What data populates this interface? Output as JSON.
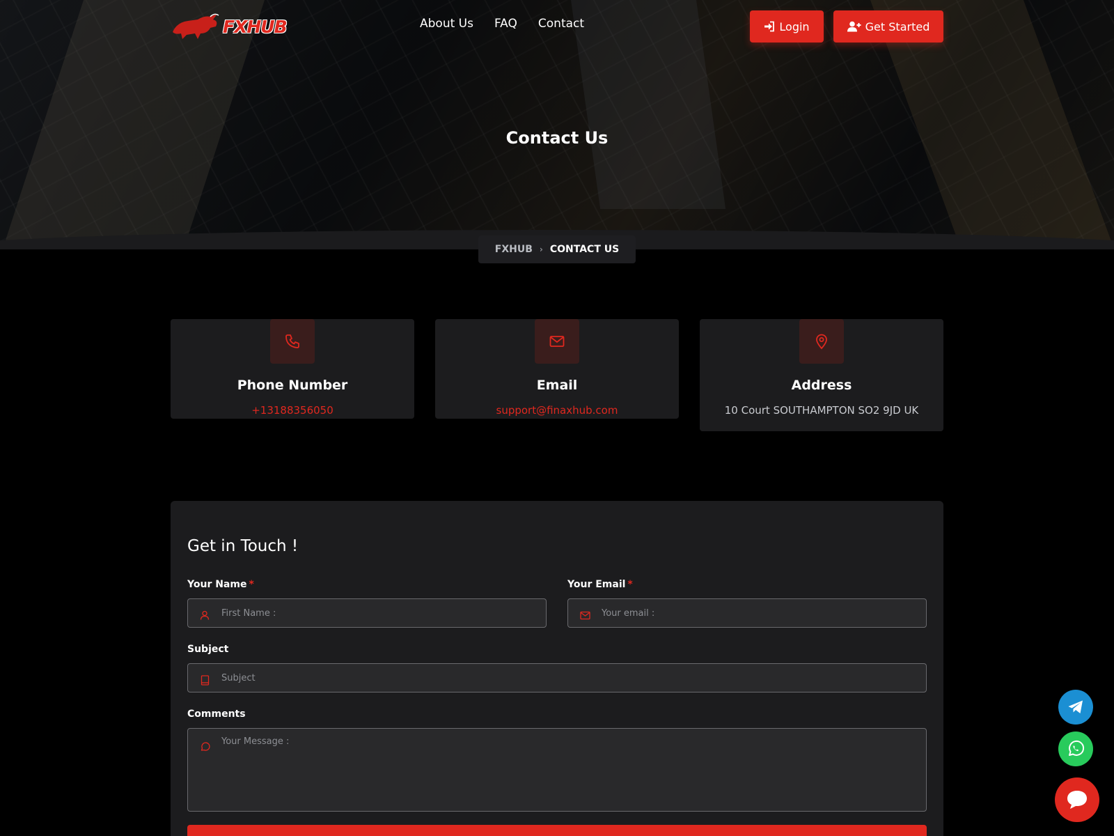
{
  "header": {
    "logo_text": "FXHUB",
    "nav": [
      {
        "label": "About Us"
      },
      {
        "label": "FAQ"
      },
      {
        "label": "Contact"
      }
    ],
    "login_label": "Login",
    "get_started_label": "Get Started"
  },
  "hero": {
    "title": "Contact Us"
  },
  "breadcrumb": {
    "home": "FXHUB",
    "current": "CONTACT US"
  },
  "cards": [
    {
      "icon": "phone-icon",
      "title": "Phone Number",
      "value": "+13188356050"
    },
    {
      "icon": "mail-icon",
      "title": "Email",
      "value": "support@finaxhub.com"
    },
    {
      "icon": "map-pin-icon",
      "title": "Address",
      "value": "10 Court SOUTHAMPTON SO2 9JD UK"
    }
  ],
  "form": {
    "title": "Get in Touch !",
    "name_label": "Your Name",
    "name_placeholder": "First Name :",
    "email_label": "Your Email",
    "email_placeholder": "Your email :",
    "required_mark": "*",
    "subject_label": "Subject",
    "subject_placeholder": "Subject",
    "comments_label": "Comments",
    "comments_placeholder": "Your Message :"
  },
  "colors": {
    "accent": "#e0281f",
    "background": "#000000",
    "card": "#1c1c1e",
    "telegram": "#1b8fd3",
    "whatsapp": "#28cb5c"
  }
}
